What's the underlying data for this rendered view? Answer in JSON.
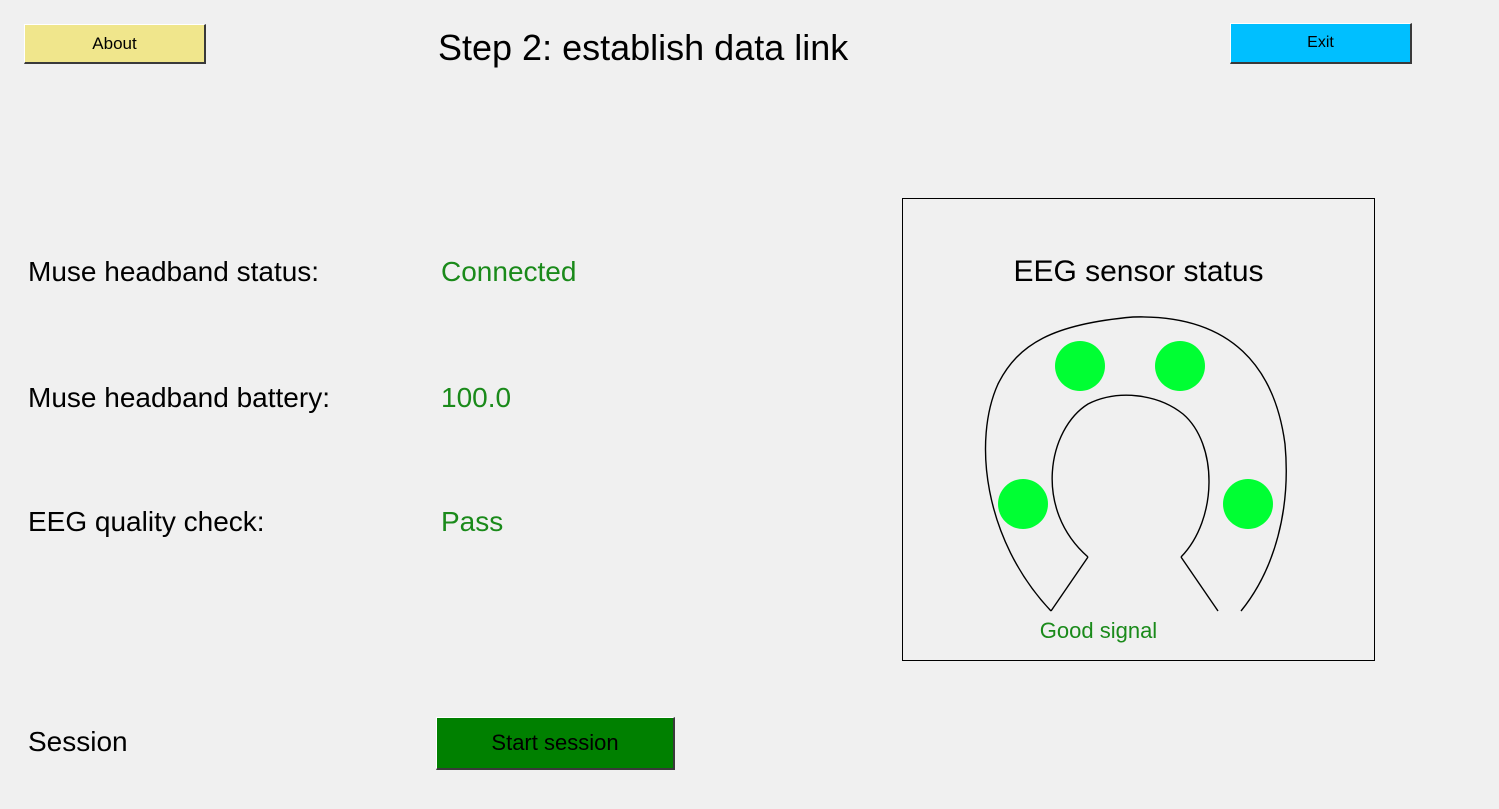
{
  "header": {
    "about_label": "About",
    "title": "Step 2: establish data link",
    "exit_label": "Exit"
  },
  "status": {
    "headband_status_label": "Muse headband status:",
    "headband_status_value": "Connected",
    "battery_label": "Muse headband battery:",
    "battery_value": "100.0",
    "quality_label": "EEG quality check:",
    "quality_value": "Pass"
  },
  "session": {
    "label": "Session",
    "start_label": "Start session"
  },
  "sensor_panel": {
    "title": "EEG sensor status",
    "signal_text": "Good signal",
    "sensor_color": "#00ff33",
    "sensor_count": 4
  },
  "colors": {
    "background": "#f0f0f0",
    "about_button": "#f0e68c",
    "exit_button": "#00bfff",
    "start_button": "#008000",
    "status_ok_text": "#1a8a1a"
  }
}
